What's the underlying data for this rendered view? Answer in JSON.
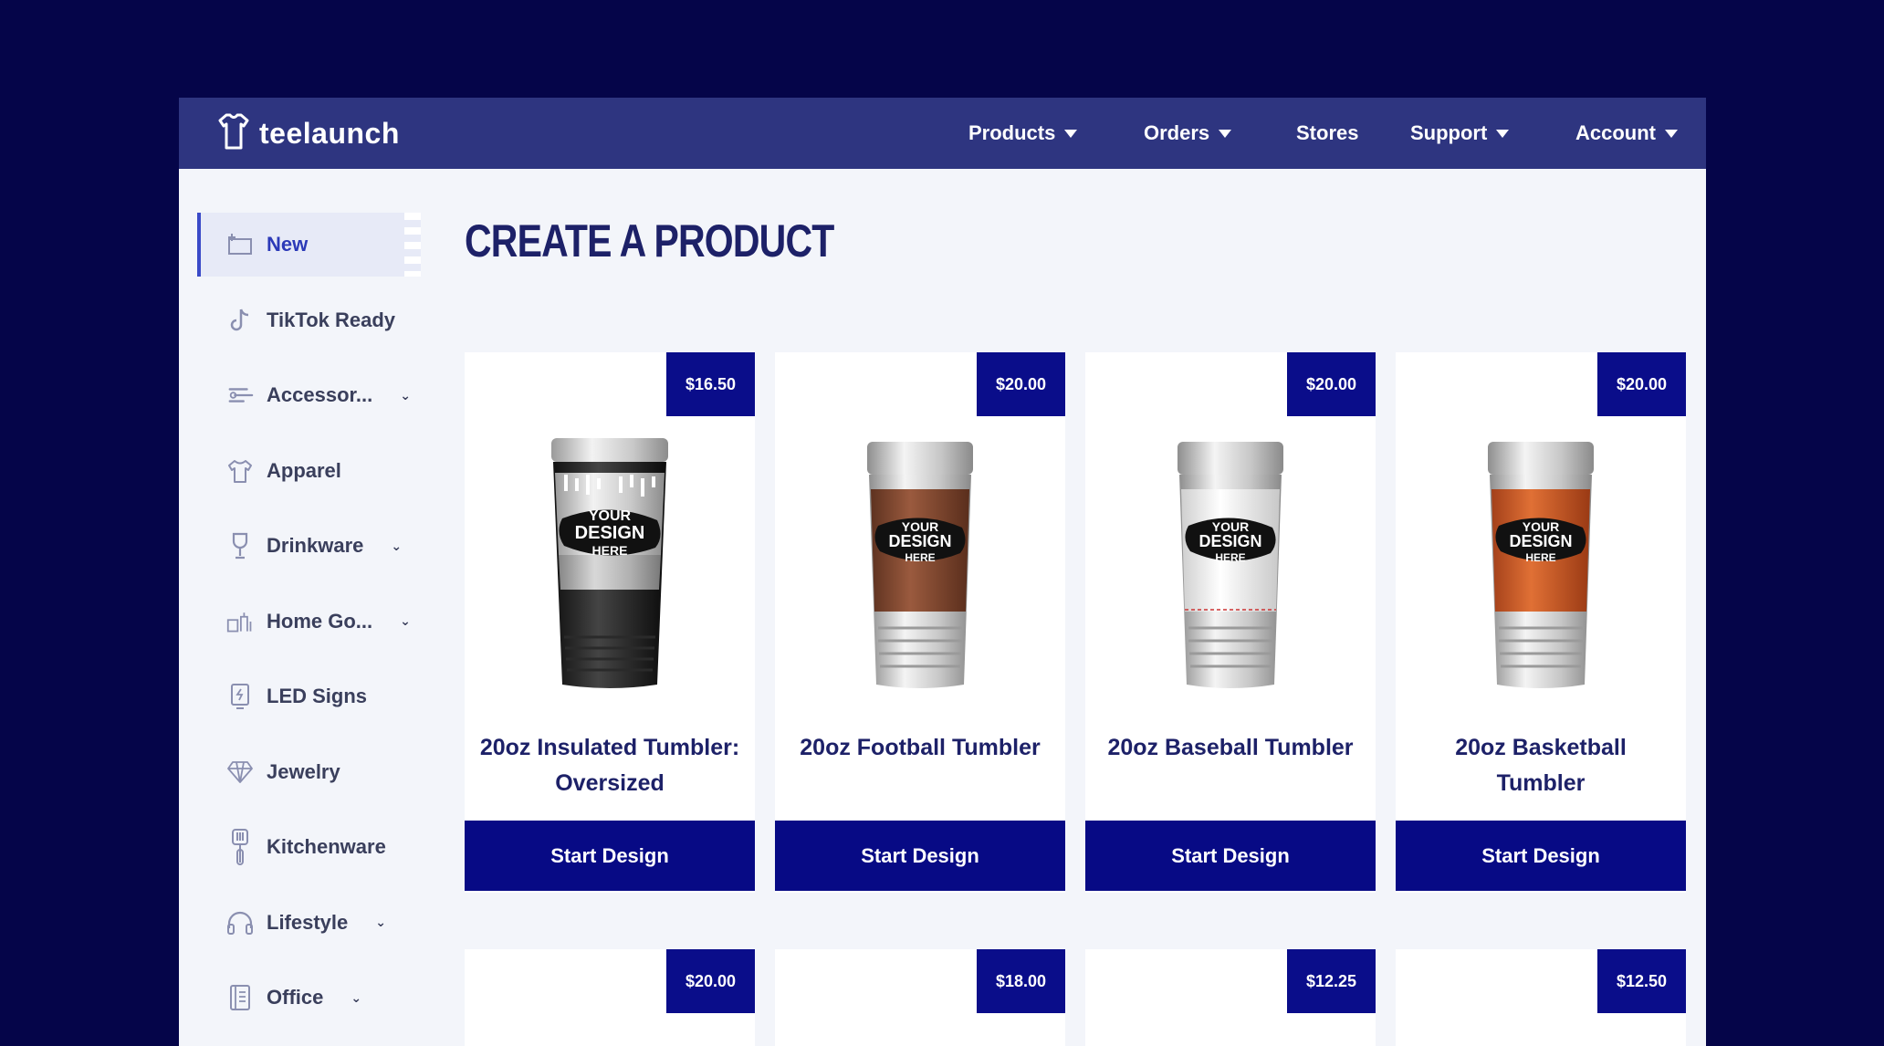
{
  "brand": {
    "name": "teelaunch",
    "logo_icon": "tshirt-outline-icon"
  },
  "nav": [
    {
      "label": "Products",
      "dropdown": true
    },
    {
      "label": "Orders",
      "dropdown": true
    },
    {
      "label": "Stores",
      "dropdown": false
    },
    {
      "label": "Support",
      "dropdown": true
    },
    {
      "label": "Account",
      "dropdown": true
    }
  ],
  "sidebar": {
    "items": [
      {
        "label": "New",
        "icon": "new-product-icon",
        "active": true,
        "expandable": false
      },
      {
        "label": "TikTok Ready",
        "icon": "tiktok-icon",
        "active": false,
        "expandable": false
      },
      {
        "label": "Accessor...",
        "icon": "accessories-icon",
        "active": false,
        "expandable": true
      },
      {
        "label": "Apparel",
        "icon": "tshirt-icon",
        "active": false,
        "expandable": false
      },
      {
        "label": "Drinkware",
        "icon": "wine-glass-icon",
        "active": false,
        "expandable": true
      },
      {
        "label": "Home Go...",
        "icon": "home-goods-icon",
        "active": false,
        "expandable": true
      },
      {
        "label": "LED Signs",
        "icon": "led-sign-icon",
        "active": false,
        "expandable": false
      },
      {
        "label": "Jewelry",
        "icon": "diamond-icon",
        "active": false,
        "expandable": false
      },
      {
        "label": "Kitchenware",
        "icon": "spatula-icon",
        "active": false,
        "expandable": false
      },
      {
        "label": "Lifestyle",
        "icon": "headphones-icon",
        "active": false,
        "expandable": true
      },
      {
        "label": "Office",
        "icon": "notebook-icon",
        "active": false,
        "expandable": true
      }
    ]
  },
  "page": {
    "title": "CREATE A PRODUCT"
  },
  "products": [
    {
      "price": "$16.50",
      "title": "20oz Insulated Tumbler: Oversized",
      "button": "Start Design",
      "variant": "black"
    },
    {
      "price": "$20.00",
      "title": "20oz Football Tumbler",
      "button": "Start Design",
      "variant": "football"
    },
    {
      "price": "$20.00",
      "title": "20oz Baseball Tumbler",
      "button": "Start Design",
      "variant": "baseball"
    },
    {
      "price": "$20.00",
      "title": "20oz Basketball Tumbler",
      "button": "Start Design",
      "variant": "basketball"
    }
  ],
  "products_row2": [
    {
      "price": "$20.00"
    },
    {
      "price": "$18.00"
    },
    {
      "price": "$12.25"
    },
    {
      "price": "$12.50"
    }
  ],
  "mockup_text": [
    "YOUR",
    "DESIGN",
    "HERE"
  ],
  "colors": {
    "background": "#050549",
    "topbar": "#2e3580",
    "accent": "#0a0d8a",
    "title": "#1d2168"
  }
}
